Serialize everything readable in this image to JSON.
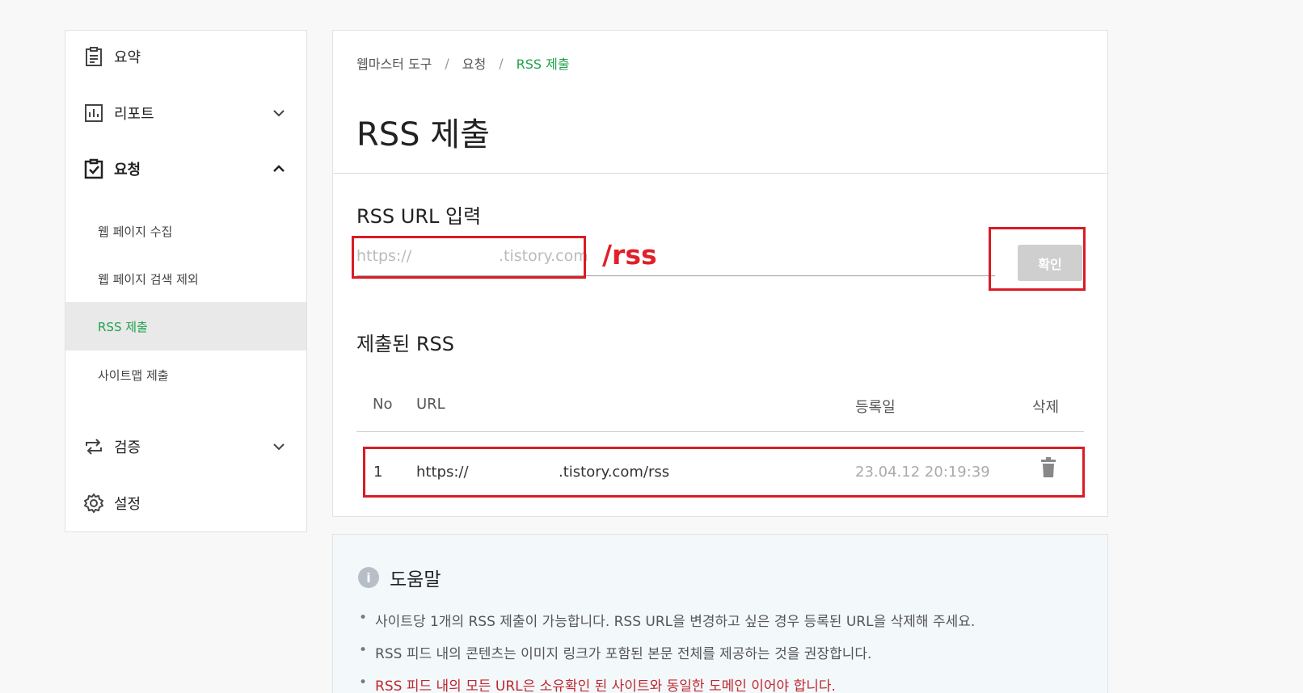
{
  "sidebar": {
    "summary": "요약",
    "report": "리포트",
    "request": "요청",
    "request_sub": [
      "웹 페이지 수집",
      "웹 페이지 검색 제외",
      "RSS 제출",
      "사이트맵 제출"
    ],
    "verify": "검증",
    "settings": "설정"
  },
  "breadcrumb": {
    "item1": "웹마스터 도구",
    "sep": "/",
    "item2": "요청",
    "current": "RSS 제출"
  },
  "page_title": "RSS 제출",
  "rss_input": {
    "section_title": "RSS URL 입력",
    "prefix": "https://",
    "suffix": ".tistory.com",
    "annotation": "/rss",
    "confirm_label": "확인"
  },
  "submitted": {
    "section_title": "제출된 RSS",
    "columns": {
      "no": "No",
      "url": "URL",
      "date": "등록일",
      "delete": "삭제"
    },
    "rows": [
      {
        "no": "1",
        "url_prefix": "https://",
        "url_suffix": ".tistory.com/rss",
        "date": "23.04.12 20:19:39"
      }
    ]
  },
  "help": {
    "icon": "i",
    "title": "도움말",
    "items": [
      "사이트당 1개의 RSS 제출이 가능합니다. RSS URL을 변경하고 싶은 경우 등록된 URL을 삭제해 주세요.",
      "RSS 피드 내의 콘텐츠는 이미지 링크가 포함된 본문 전체를 제공하는 것을 권장합니다.",
      "RSS 피드 내의 모든 URL은 소유확인 된 사이트와 동일한 도메인 이어야 합니다."
    ]
  },
  "colors": {
    "accent_green": "#1ea34a",
    "annotation_red": "#d91c25",
    "warn_red": "#c0282e"
  }
}
